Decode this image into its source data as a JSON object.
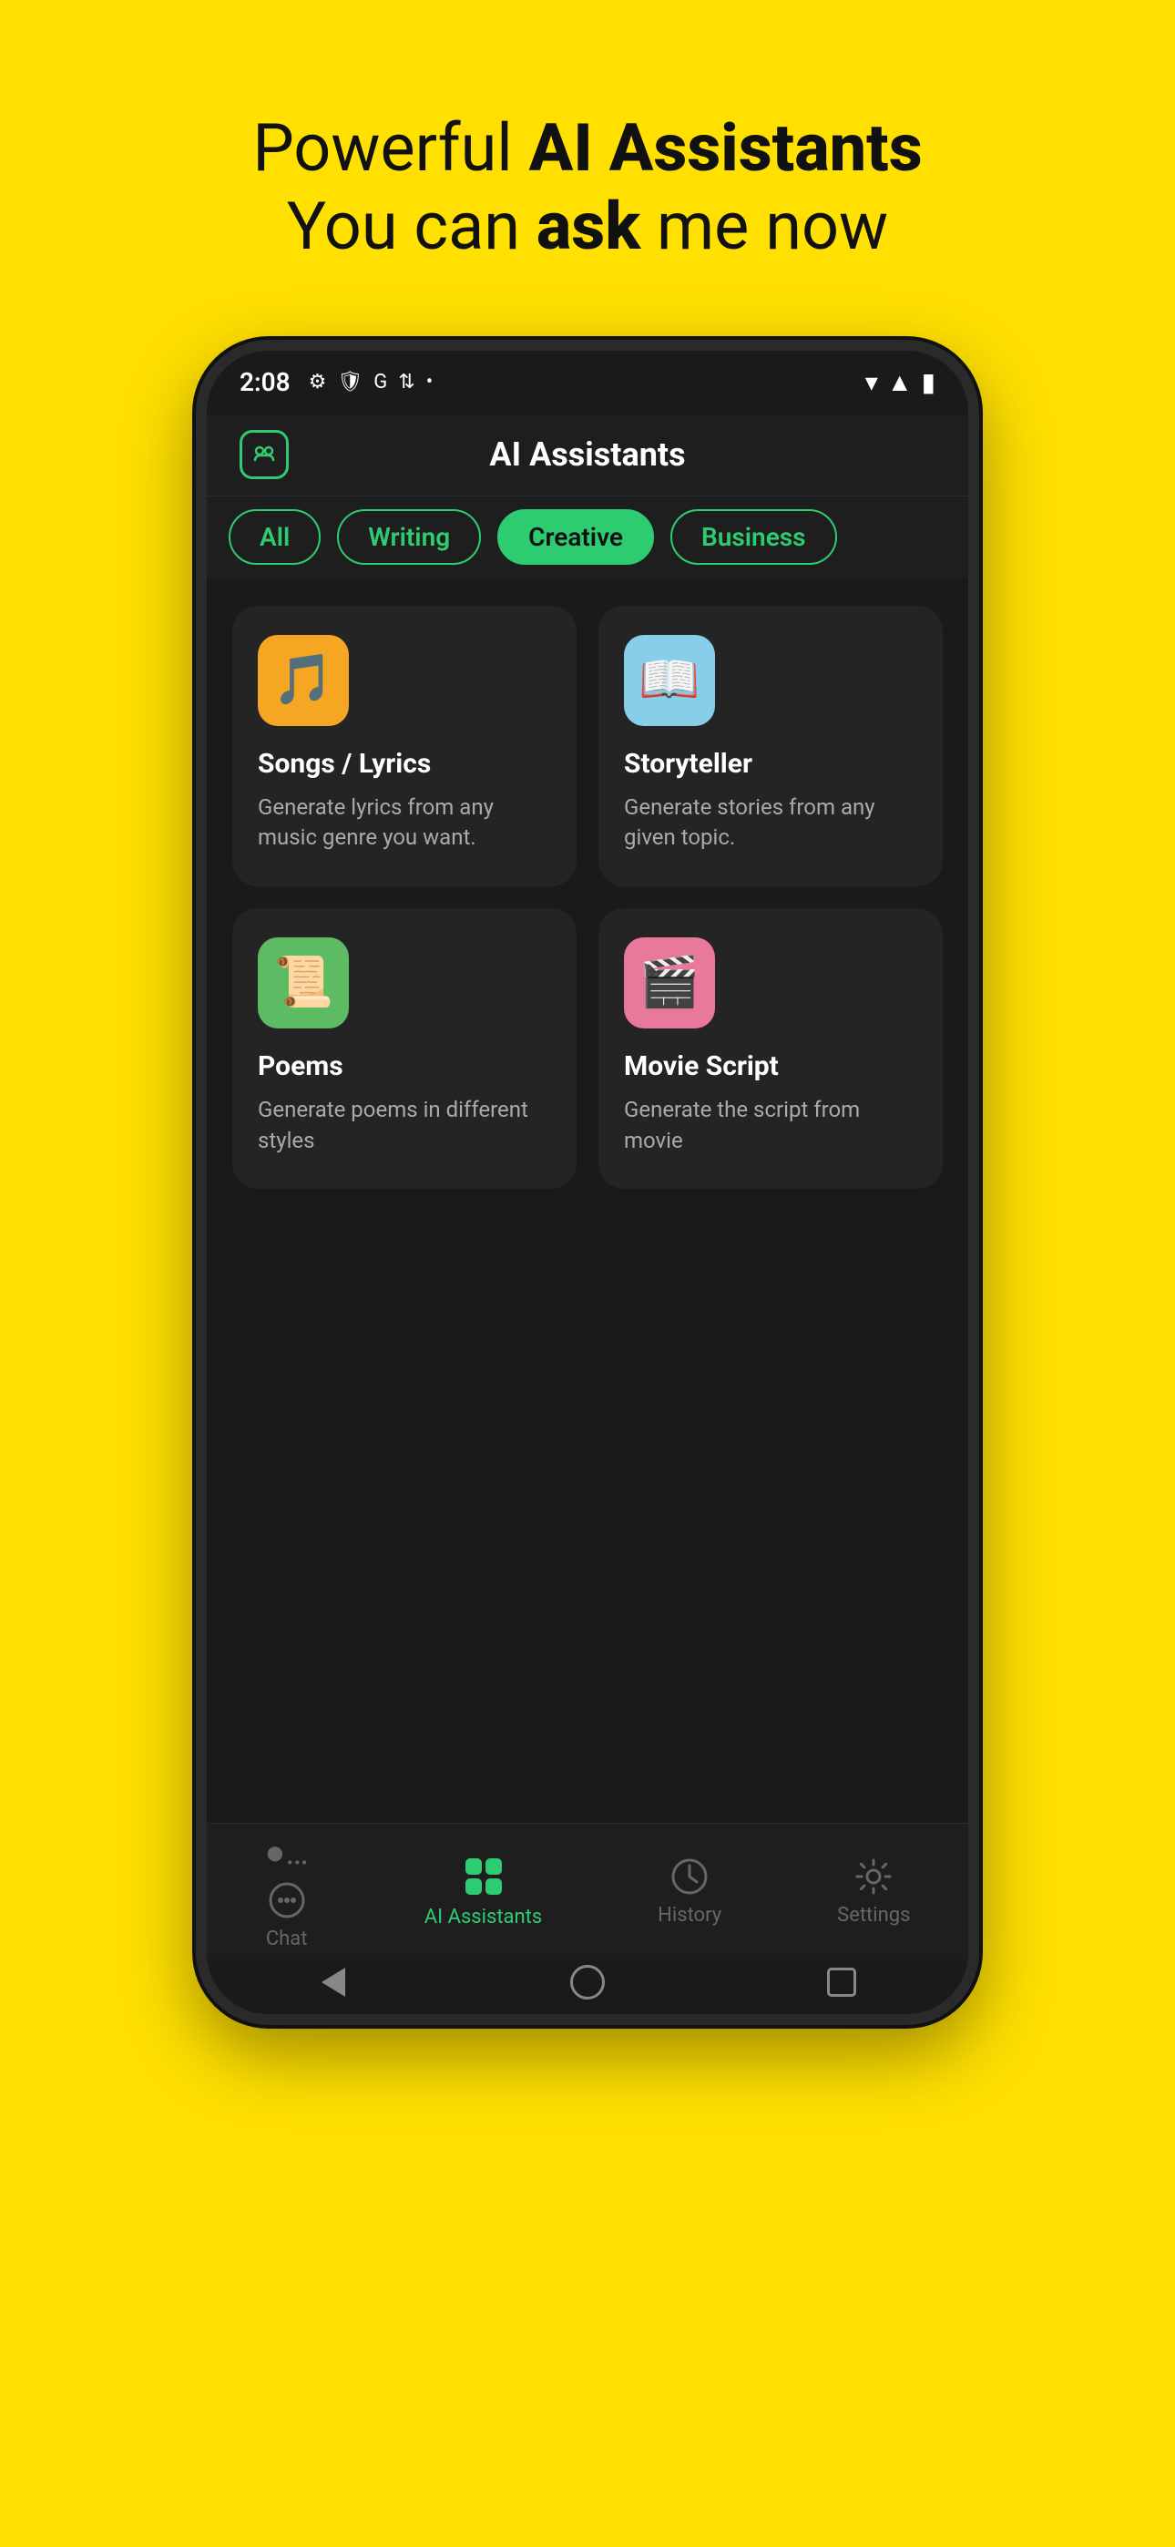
{
  "hero": {
    "line1_normal": "Powerful ",
    "line1_bold": "AI Assistants",
    "line2_normal": "You can ",
    "line2_bold": "ask",
    "line2_normal2": " me now"
  },
  "phone": {
    "status": {
      "time": "2:08"
    },
    "header": {
      "title": "AI Assistants"
    },
    "filters": [
      {
        "label": "All",
        "active": false
      },
      {
        "label": "Writing",
        "active": false
      },
      {
        "label": "Creative",
        "active": true
      },
      {
        "label": "Business",
        "active": false
      }
    ],
    "cards": [
      {
        "icon": "🎵",
        "icon_style": "yellow",
        "title": "Songs / Lyrics",
        "description": "Generate lyrics from any music genre you want."
      },
      {
        "icon": "📖",
        "icon_style": "blue",
        "title": "Storyteller",
        "description": "Generate stories from any given topic."
      },
      {
        "icon": "📜",
        "icon_style": "green",
        "title": "Poems",
        "description": "Generate poems in different styles"
      },
      {
        "icon": "🎬",
        "icon_style": "pink",
        "title": "Movie Script",
        "description": "Generate the script from movie"
      }
    ],
    "nav": [
      {
        "icon": "💬",
        "label": "Chat",
        "active": false
      },
      {
        "icon": "⊞",
        "label": "AI Assistants",
        "active": true
      },
      {
        "icon": "🕐",
        "label": "History",
        "active": false
      },
      {
        "icon": "⚙️",
        "label": "Settings",
        "active": false
      }
    ]
  }
}
